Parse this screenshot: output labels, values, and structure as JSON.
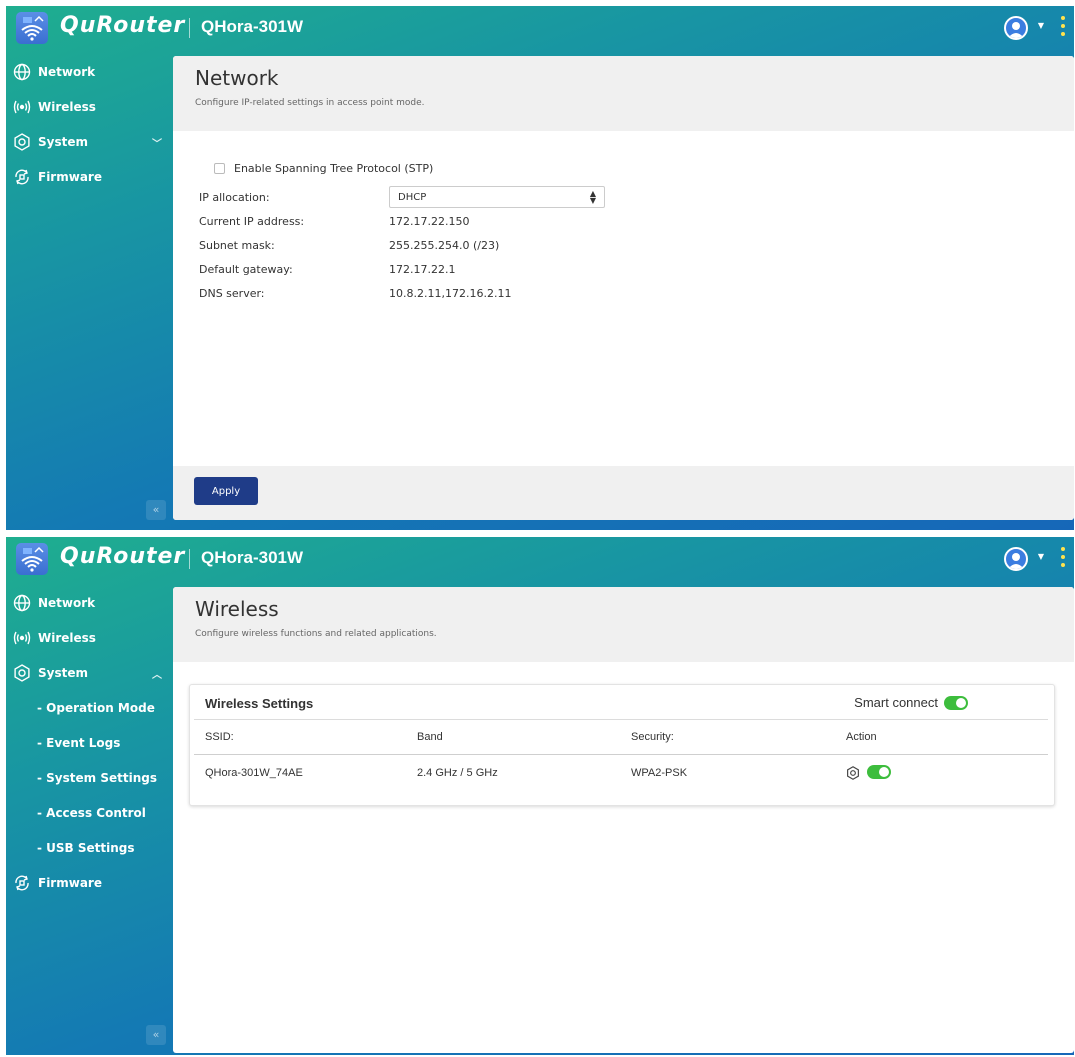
{
  "app": {
    "brand": "QuRouter",
    "model": "QHora-301W"
  },
  "icons": {
    "logo": "router-wifi-logo",
    "user": "user-avatar-icon",
    "menu": "kebab-menu-icon",
    "network": "globe-icon",
    "wireless": "wireless-signal-icon",
    "system": "gear-icon",
    "firmware": "firmware-refresh-icon"
  },
  "colors": {
    "accent": "#1f3c88",
    "toggle_on": "#3dbd3d",
    "kebab": "#ffe34d"
  },
  "shot1": {
    "sidebar": {
      "items": [
        {
          "label": "Network"
        },
        {
          "label": "Wireless"
        },
        {
          "label": "System",
          "expanded": false
        },
        {
          "label": "Firmware"
        }
      ],
      "collapse_glyph": "«"
    },
    "page": {
      "title": "Network",
      "subtitle": "Configure IP-related settings in access point mode.",
      "stp_label": "Enable Spanning Tree Protocol (STP)",
      "stp_checked": false,
      "fields": [
        {
          "label": "IP allocation:",
          "value": "DHCP"
        },
        {
          "label": "Current IP address:",
          "value": "172.17.22.150"
        },
        {
          "label": "Subnet mask:",
          "value": "255.255.254.0 (/23)"
        },
        {
          "label": "Default gateway:",
          "value": "172.17.22.1"
        },
        {
          "label": "DNS server:",
          "value": "10.8.2.11,172.16.2.11"
        }
      ],
      "apply_label": "Apply"
    }
  },
  "shot2": {
    "sidebar": {
      "items": [
        {
          "label": "Network"
        },
        {
          "label": "Wireless"
        },
        {
          "label": "System",
          "expanded": true
        },
        {
          "label": "Firmware"
        }
      ],
      "subitems": [
        {
          "label": "- Operation Mode"
        },
        {
          "label": "- Event Logs"
        },
        {
          "label": "- System Settings"
        },
        {
          "label": "- Access Control"
        },
        {
          "label": "- USB Settings"
        }
      ],
      "collapse_glyph": "«"
    },
    "page": {
      "title": "Wireless",
      "subtitle": "Configure wireless functions and related applications.",
      "card_title": "Wireless Settings",
      "smart_connect_label": "Smart connect",
      "smart_connect_on": true,
      "columns": [
        "SSID:",
        "Band",
        "Security:",
        "Action"
      ],
      "rows": [
        {
          "ssid": "QHora-301W_74AE",
          "band": "2.4 GHz / 5 GHz",
          "security": "WPA2-PSK",
          "enabled": true
        }
      ]
    }
  }
}
